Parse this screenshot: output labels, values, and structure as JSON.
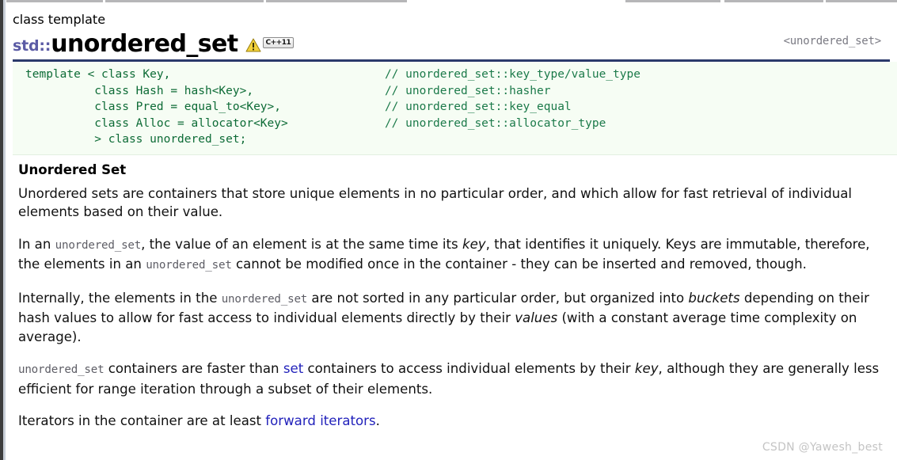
{
  "window": {
    "left_border_color": "#3d3d3d"
  },
  "header": {
    "kind_label": "class template",
    "namespace": "std::",
    "title": "unordered_set",
    "badges": {
      "warning_icon": "warning-triangle-icon",
      "std_version": "C++11"
    },
    "include": "<unordered_set>",
    "rule_color": "#2b3a6b"
  },
  "code": {
    "background": "#f6fdf4",
    "text_color": "#0d6b36",
    "lines": [
      {
        "code": "template < class Key,",
        "comment": "// unordered_set::key_type/value_type"
      },
      {
        "code": "          class Hash = hash<Key>,",
        "comment": "// unordered_set::hasher"
      },
      {
        "code": "          class Pred = equal_to<Key>,",
        "comment": "// unordered_set::key_equal"
      },
      {
        "code": "          class Alloc = allocator<Key>",
        "comment": "// unordered_set::allocator_type"
      },
      {
        "code": "          > class unordered_set;",
        "comment": ""
      }
    ]
  },
  "content": {
    "section_title": "Unordered Set",
    "paragraphs": [
      {
        "id": "intro",
        "parts": [
          {
            "type": "text",
            "value": "Unordered sets are containers that store unique elements in no particular order, and which allow for fast retrieval of individual elements based on their value."
          }
        ]
      },
      {
        "id": "key-immutable",
        "parts": [
          {
            "type": "text",
            "value": "In an "
          },
          {
            "type": "code",
            "value": "unordered_set"
          },
          {
            "type": "text",
            "value": ", the value of an element is at the same time its "
          },
          {
            "type": "italic",
            "value": "key"
          },
          {
            "type": "text",
            "value": ", that identifies it uniquely. Keys are immutable, therefore, the elements in an "
          },
          {
            "type": "code",
            "value": "unordered_set"
          },
          {
            "type": "text",
            "value": " cannot be modified once in the container - they can be inserted and removed, though."
          }
        ]
      },
      {
        "id": "buckets",
        "parts": [
          {
            "type": "text",
            "value": "Internally, the elements in the "
          },
          {
            "type": "code",
            "value": "unordered_set"
          },
          {
            "type": "text",
            "value": " are not sorted in any particular order, but organized into "
          },
          {
            "type": "italic",
            "value": "buckets"
          },
          {
            "type": "text",
            "value": " depending on their hash values to allow for fast access to individual elements directly by their "
          },
          {
            "type": "italic",
            "value": "values"
          },
          {
            "type": "text",
            "value": " (with a constant average time complexity on average)."
          }
        ]
      },
      {
        "id": "vs-set",
        "parts": [
          {
            "type": "code",
            "value": "unordered_set"
          },
          {
            "type": "text",
            "value": " containers are faster than "
          },
          {
            "type": "link",
            "value": "set"
          },
          {
            "type": "text",
            "value": " containers to access individual elements by their "
          },
          {
            "type": "italic",
            "value": "key"
          },
          {
            "type": "text",
            "value": ", although they are generally less efficient for range iteration through a subset of their elements."
          }
        ]
      },
      {
        "id": "iterators",
        "parts": [
          {
            "type": "text",
            "value": "Iterators in the container are at least "
          },
          {
            "type": "link",
            "value": "forward iterators"
          },
          {
            "type": "text",
            "value": "."
          }
        ]
      }
    ],
    "link_color": "#2222bb",
    "inline_code_color": "#5e5e66"
  },
  "watermark": {
    "text": "CSDN @Yawesh_best"
  }
}
